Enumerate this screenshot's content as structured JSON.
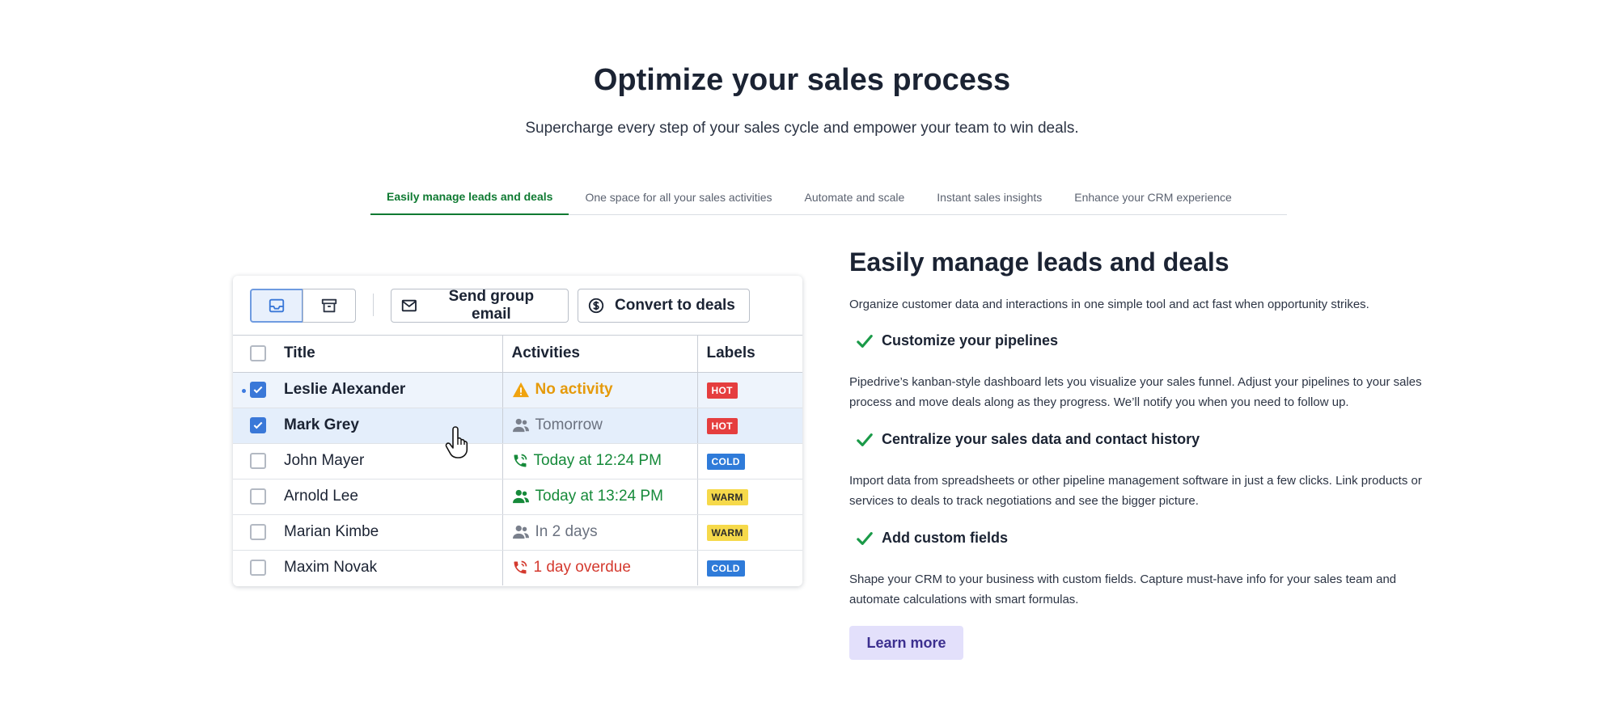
{
  "header": {
    "title": "Optimize your sales process",
    "subtitle": "Supercharge every step of your sales cycle and empower your team to win deals."
  },
  "tabs": [
    {
      "label": "Easily manage leads and deals",
      "active": true
    },
    {
      "label": "One space for all your sales activities",
      "active": false
    },
    {
      "label": "Automate and scale",
      "active": false
    },
    {
      "label": "Instant sales insights",
      "active": false
    },
    {
      "label": "Enhance your CRM experience",
      "active": false
    }
  ],
  "toolbar": {
    "send_email_label": "Send group email",
    "convert_label": "Convert to deals"
  },
  "table": {
    "headers": {
      "title": "Title",
      "activities": "Activities",
      "labels": "Labels"
    },
    "rows": [
      {
        "title": "Leslie Alexander",
        "activity": "No activity",
        "activity_kind": "warning",
        "label": "HOT",
        "checked": true
      },
      {
        "title": "Mark Grey",
        "activity": "Tomorrow",
        "activity_kind": "meeting-grey",
        "label": "HOT",
        "checked": true
      },
      {
        "title": "John Mayer",
        "activity": "Today at 12:24 PM",
        "activity_kind": "call-green",
        "label": "COLD",
        "checked": false
      },
      {
        "title": "Arnold Lee",
        "activity": "Today at 13:24 PM",
        "activity_kind": "meeting-green",
        "label": "WARM",
        "checked": false
      },
      {
        "title": "Marian Kimbe",
        "activity": "In 2 days",
        "activity_kind": "meeting-grey",
        "label": "WARM",
        "checked": false
      },
      {
        "title": "Maxim Novak",
        "activity": "1 day overdue",
        "activity_kind": "call-red",
        "label": "COLD",
        "checked": false
      }
    ]
  },
  "content": {
    "title": "Easily manage leads and deals",
    "intro": "Organize customer data and interactions in one simple tool and act fast when opportunity strikes.",
    "features": [
      {
        "title": "Customize your pipelines",
        "text": "Pipedrive’s kanban-style dashboard lets you visualize your sales funnel. Adjust your pipelines to your sales process and move deals along as they progress. We’ll notify you when you need to follow up."
      },
      {
        "title": "Centralize your sales data and contact history",
        "text": "Import data from spreadsheets or other pipeline management software in just a few clicks. Link products or services to deals to track negotiations and see the bigger picture."
      },
      {
        "title": "Add custom fields",
        "text": "Shape your CRM to your business with custom fields. Capture must-have info for your sales team and automate calculations with smart formulas."
      }
    ],
    "learn_more_label": "Learn more"
  },
  "colors": {
    "accent_green": "#0f7a32",
    "check_blue": "#3a78d8",
    "learn_bg": "#e3e0fb"
  }
}
